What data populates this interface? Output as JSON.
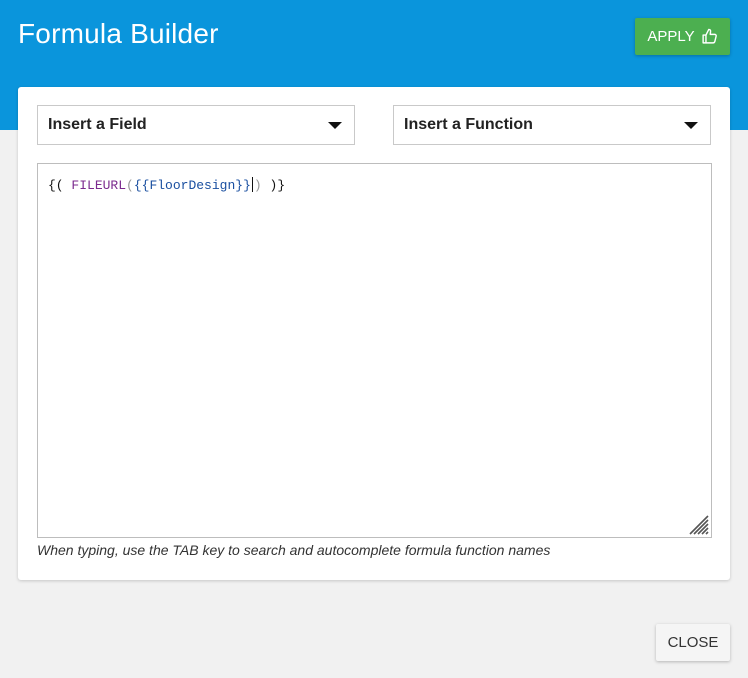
{
  "window": {
    "title": "Formula Builder",
    "accent_color": "#0a95dc"
  },
  "toolbar": {
    "apply_label": "APPLY",
    "apply_icon": "thumbs-up-icon",
    "apply_color": "#4caf50"
  },
  "selects": {
    "field_label": "Insert a Field",
    "function_label": "Insert a Function"
  },
  "editor": {
    "tokens": {
      "open_outer": "{(",
      "func_name": "FILEURL",
      "open_func": "(",
      "field_open": "{{",
      "field_name": "FloorDesign",
      "field_close": "}}",
      "close_func": ")",
      "close_outer": ")}"
    },
    "full_text": "{( FILEURL({{FloorDesign}}) )}"
  },
  "hint": "When typing, use the TAB key to search and autocomplete formula function names",
  "footer": {
    "close_label": "CLOSE"
  }
}
